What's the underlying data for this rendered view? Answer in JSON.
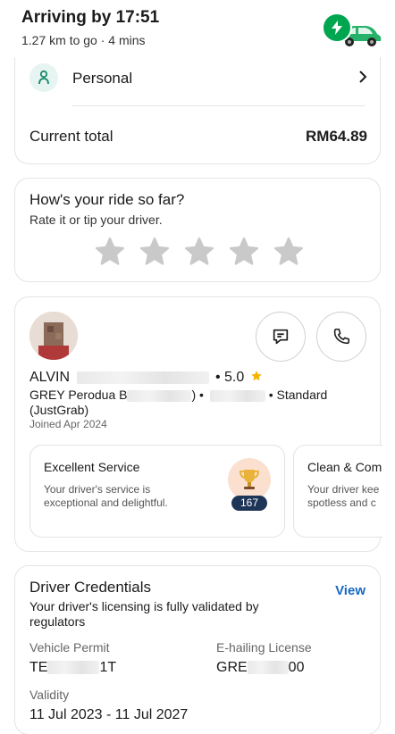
{
  "header": {
    "title": "Arriving by 17:51",
    "subtitle": "1.27 km to go · 4 mins",
    "car_icon": "green-car-icon",
    "badge_icon": "lightning-bolt-icon"
  },
  "payment": {
    "method_icon": "profile-icon",
    "method_label": "Personal",
    "total_label": "Current total",
    "total_value": "RM64.89"
  },
  "rating": {
    "question": "How's your ride so far?",
    "prompt": "Rate it or tip your driver.",
    "stars": 5,
    "selected": 0
  },
  "driver": {
    "name": "ALVIN",
    "rating": "• 5.0",
    "vehicle_prefix": "GREY Perodua B",
    "vehicle_suffix": ")  •",
    "service": "• Standard",
    "service_type": "(JustGrab)",
    "joined": "Joined Apr 2024",
    "compliments": [
      {
        "title": "Excellent Service",
        "description": "Your driver's service is exceptional and delightful.",
        "count": "167",
        "icon": "trophy-icon"
      },
      {
        "title": "Clean & Com",
        "description": "Your driver kee spotless and c"
      }
    ]
  },
  "credentials": {
    "title": "Driver Credentials",
    "view_label": "View",
    "description": "Your driver's licensing is fully validated by regulators",
    "permit_label": "Vehicle Permit",
    "permit_prefix": "TE",
    "permit_suffix": "1T",
    "license_label": "E-hailing License",
    "license_prefix": "GRE",
    "license_suffix": "00",
    "validity_label": "Validity",
    "validity_value": "11 Jul 2023 - 11 Jul 2027"
  },
  "colors": {
    "brand_green": "#00a64f",
    "link_blue": "#1769c4",
    "badge_navy": "#1f3557",
    "star_gray": "#c9c9c9"
  }
}
